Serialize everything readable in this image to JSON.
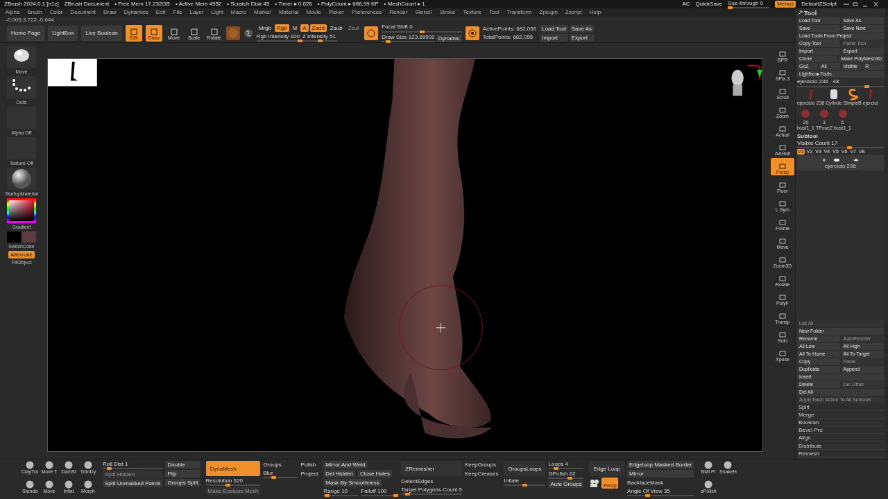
{
  "title_bar": {
    "app": "ZBrush 2024.0.1 [n1z]",
    "document": "ZBrush Document",
    "stats": [
      "• Free Mem 17.232GB",
      "• Active Mem 4952",
      "• Scratch Disk 45",
      "• Timer ▸ 0.026",
      "• PolyCount ▸ 686.99 KP",
      "• MeshCount ▸ 1"
    ],
    "right": [
      {
        "label": "AC",
        "kind": "text"
      },
      {
        "label": "QuickSave",
        "kind": "text"
      },
      {
        "label": "See-through",
        "value": "0",
        "kind": "slider",
        "level": 0.05
      },
      {
        "label": "Menus",
        "kind": "button",
        "selected": true
      },
      {
        "label": "DefaultZScript",
        "kind": "text"
      }
    ]
  },
  "menu": [
    "Alpha",
    "Brush",
    "Color",
    "Document",
    "Draw",
    "Dynamics",
    "Edit",
    "File",
    "Layer",
    "Light",
    "Macro",
    "Marker",
    "Material",
    "Movie",
    "Picker",
    "Preferences",
    "Render",
    "Stencil",
    "Stroke",
    "Texture",
    "Tool",
    "Transform",
    "Zplugin",
    "Zscript",
    "Help"
  ],
  "coordinates": "-0.009,3.722,-0.644",
  "top_shelf": {
    "nav_buttons": [
      "Home Page",
      "LightBox",
      "Live Boolean"
    ],
    "tools": [
      {
        "label": "Edit",
        "selected": true
      },
      {
        "label": "Draw",
        "selected": true
      },
      {
        "label": "Move",
        "selected": false
      },
      {
        "label": "Scale",
        "selected": false
      },
      {
        "label": "Rotate",
        "selected": false
      }
    ],
    "modes": [
      {
        "label": "Mrgb",
        "selected": false
      },
      {
        "label": "Rgb",
        "selected": true
      },
      {
        "label": "M",
        "selected": false
      },
      {
        "label": "A",
        "selected": true
      },
      {
        "label": "Zadd",
        "selected": true
      },
      {
        "label": "Zsub",
        "selected": false
      },
      {
        "label": "Zcut",
        "selected": false,
        "disabled": true
      }
    ],
    "intensity": [
      {
        "label": "Rgb Intensity",
        "value": "100",
        "level": 1
      },
      {
        "label": "Z Intensity",
        "value": "51",
        "level": 0.51
      }
    ],
    "focal_shift": {
      "label": "Focal Shift",
      "value": "0",
      "level": 0.5
    },
    "draw_size": {
      "label": "Draw Size",
      "value": "123.89992",
      "level": 0.12
    },
    "dynamic": "Dynamic",
    "points": [
      "ActivePoints: 682,055",
      "TotalPoints: 682,055"
    ],
    "file_buttons": [
      "Load Tool",
      "Import",
      "Save As",
      "Export"
    ]
  },
  "left_panel": {
    "thumbs": [
      {
        "label": "Move",
        "kind": "brush"
      },
      {
        "label": "Dots",
        "kind": "stroke"
      },
      {
        "label": "Alpha Off",
        "kind": "empty"
      },
      {
        "label": "Texture Off",
        "kind": "empty"
      },
      {
        "label": "StartupMaterial",
        "kind": "material"
      }
    ],
    "gradient": "Gradient",
    "switch_color": "SwitchColor",
    "alternate": {
      "label": "Alternate",
      "selected": true
    },
    "fill_object": "FillObject"
  },
  "right_shelf": [
    {
      "label": "BPR",
      "selected": false
    },
    {
      "label": "SPix 3",
      "selected": false
    },
    {
      "label": "Scroll",
      "selected": false
    },
    {
      "label": "Zoom",
      "selected": false
    },
    {
      "label": "Actual",
      "selected": false
    },
    {
      "label": "AAHalf",
      "selected": false
    },
    {
      "label": "Persp",
      "selected": true
    },
    {
      "label": "Floor",
      "selected": false
    },
    {
      "label": "L.Sym",
      "selected": false
    },
    {
      "label": "Frame",
      "selected": false
    },
    {
      "label": "Move",
      "selected": false
    },
    {
      "label": "Zoom3D",
      "selected": false
    },
    {
      "label": "Rotate",
      "selected": false
    },
    {
      "label": "PolyF",
      "selected": false
    },
    {
      "label": "Transp",
      "selected": false
    },
    {
      "label": "Solo",
      "selected": false
    },
    {
      "label": "Xpose",
      "selected": false
    }
  ],
  "tool_panel": {
    "title": "Tool",
    "rows": [
      [
        {
          "label": "Load Tool"
        },
        {
          "label": "Save As"
        }
      ],
      [
        {
          "label": "Save"
        },
        {
          "label": "Save Next"
        }
      ],
      [
        {
          "label": "Load Tools From Project"
        }
      ],
      [
        {
          "label": "Copy Tool"
        },
        {
          "label": "Paste Tool",
          "disabled": true
        }
      ],
      [
        {
          "label": "Import"
        },
        {
          "label": "Export"
        }
      ],
      [
        {
          "label": "Clone"
        },
        {
          "label": "Make PolyMesh3D"
        }
      ],
      [
        {
          "label": "GoZ"
        },
        {
          "label": "All"
        },
        {
          "label": "Visible"
        },
        {
          "label": "R"
        }
      ],
      [
        {
          "label": "Lightbox▸Tools"
        }
      ]
    ],
    "tool_slider": {
      "label": "ejercicio 236 . 48",
      "level": 0.8
    },
    "thumbs": [
      {
        "label": "ejercicio 236",
        "kind": "mesh"
      },
      {
        "label": "Cylinde",
        "kind": "cylinder"
      },
      {
        "label": "SimpleB",
        "kind": "simple"
      },
      {
        "label": "ejercici",
        "kind": "mesh"
      },
      {
        "label": "bust1_1",
        "kind": "bust",
        "count": "20"
      },
      {
        "label": "TPose2",
        "kind": "bust",
        "count": "3"
      },
      {
        "label": "bust1_1",
        "kind": "bust",
        "count": "6"
      }
    ],
    "subtool": {
      "title": "Subtool",
      "visible_count": {
        "label": "Visible Count",
        "value": "17",
        "level": 0.6
      },
      "versions": [
        {
          "label": "V1",
          "selected": true
        },
        {
          "label": "V2",
          "selected": false
        },
        {
          "label": "V3",
          "selected": false
        },
        {
          "label": "V4",
          "selected": false
        },
        {
          "label": "V5",
          "selected": false
        },
        {
          "label": "V6",
          "selected": false
        },
        {
          "label": "V7",
          "selected": false
        },
        {
          "label": "V8",
          "selected": false
        }
      ],
      "item": "ejercicio 236"
    },
    "actions": [
      [
        {
          "label": "List All",
          "disabled": true
        }
      ],
      [
        {
          "label": "New Folder"
        }
      ],
      [
        {
          "label": "Rename"
        },
        {
          "label": "AutoReorder",
          "disabled": true
        }
      ],
      [
        {
          "label": "All Low"
        },
        {
          "label": "All High"
        }
      ],
      [
        {
          "label": "All To Home"
        },
        {
          "label": "All To Target"
        }
      ],
      [
        {
          "label": "Copy"
        },
        {
          "label": "Paste",
          "disabled": true
        }
      ],
      [
        {
          "label": "Duplicate"
        },
        {
          "label": "Append"
        }
      ],
      [
        {
          "label": "Insert"
        }
      ],
      [
        {
          "label": "Delete"
        },
        {
          "label": "Del Other",
          "disabled": true
        }
      ],
      [
        {
          "label": "Del All"
        }
      ],
      [
        {
          "label": "Apply Each Action To All Subtools",
          "disabled": true
        }
      ]
    ],
    "list": [
      "Split",
      "Merge",
      "Boolean",
      "Bevel Pro",
      "Align",
      "Distribute",
      "Remesh"
    ]
  },
  "bottom_shelf": {
    "brushes": [
      "ClayTut",
      "Move T",
      "DamSt",
      "TrimDy",
      "Standa",
      "Move",
      "Inflat",
      "Morph"
    ],
    "groups": [
      {
        "columns": [
          [
            {
              "kind": "slider",
              "label": "Roll Dist",
              "value": "1",
              "level": 0.1
            },
            {
              "kind": "button",
              "label": "Split Hidden",
              "disabled": true
            },
            {
              "kind": "button",
              "label": "Split Unmasked Points"
            }
          ],
          [
            {
              "kind": "button",
              "label": "Double"
            },
            {
              "kind": "button",
              "label": "Flip"
            },
            {
              "kind": "button",
              "label": "Groups Split"
            }
          ]
        ]
      },
      {
        "columns": [
          [
            {
              "kind": "big",
              "label": "DynaMesh",
              "selected": true
            },
            {
              "kind": "slider",
              "label": "Resolution",
              "value": "520",
              "level": 0.4
            },
            {
              "kind": "button",
              "label": "Make Boolean Mesh",
              "disabled": true
            }
          ],
          [
            {
              "kind": "text",
              "label": "Groups"
            },
            {
              "kind": "slider",
              "label": "Blur",
              "level": 0.3
            }
          ],
          [
            {
              "kind": "text",
              "label": "Polish"
            },
            {
              "kind": "text",
              "label": "Project"
            }
          ]
        ]
      },
      {
        "rows": [
          [
            {
              "kind": "button",
              "label": "Mirror And Weld"
            }
          ],
          [
            {
              "kind": "button",
              "label": "Del Hidden"
            },
            {
              "kind": "button",
              "label": "Close Holes"
            }
          ],
          [
            {
              "kind": "button",
              "label": "Mask By Smoothness"
            }
          ],
          [
            {
              "kind": "slider",
              "label": "Range",
              "value": "10",
              "level": 0.1
            },
            {
              "kind": "slider",
              "label": "Falloff",
              "value": "100",
              "level": 1
            }
          ]
        ]
      },
      {
        "columns": [
          [
            {
              "kind": "big",
              "label": "ZRemesher",
              "selected": false
            },
            {
              "kind": "text",
              "label": "DetectEdges"
            },
            {
              "kind": "slider",
              "label": "Target Polygons Count",
              "value": "5",
              "level": 0.1
            }
          ],
          [
            {
              "kind": "text",
              "label": "KeepGroups"
            },
            {
              "kind": "text",
              "label": "KeepCreases"
            }
          ]
        ]
      },
      {
        "columns": [
          [
            {
              "kind": "big",
              "label": "GroupsLoops",
              "selected": false
            },
            {
              "kind": "slider",
              "label": "Inflate",
              "level": 0.5
            }
          ],
          [
            {
              "kind": "slider",
              "label": "Loops",
              "value": "4",
              "level": 0.2
            },
            {
              "kind": "slider",
              "label": "GPolish",
              "value": "62",
              "level": 0.6
            },
            {
              "kind": "button",
              "label": "Auto Groups"
            }
          ]
        ]
      },
      {
        "columns": [
          [
            {
              "kind": "big",
              "label": "Edge Loop",
              "selected": false
            },
            {
              "kind": "camera",
              "label": "Persp",
              "selected": true
            }
          ],
          [
            {
              "kind": "button",
              "label": "Edgeloop Masked Border"
            },
            {
              "kind": "button",
              "label": "Mirror"
            },
            {
              "kind": "text",
              "label": "BackfaceMask"
            },
            {
              "kind": "slider",
              "label": "Angle Of View",
              "value": "35",
              "level": 0.3
            }
          ]
        ]
      }
    ],
    "extra_brushes": [
      "BMI Pr",
      "SnakeH",
      "sPolish"
    ]
  }
}
